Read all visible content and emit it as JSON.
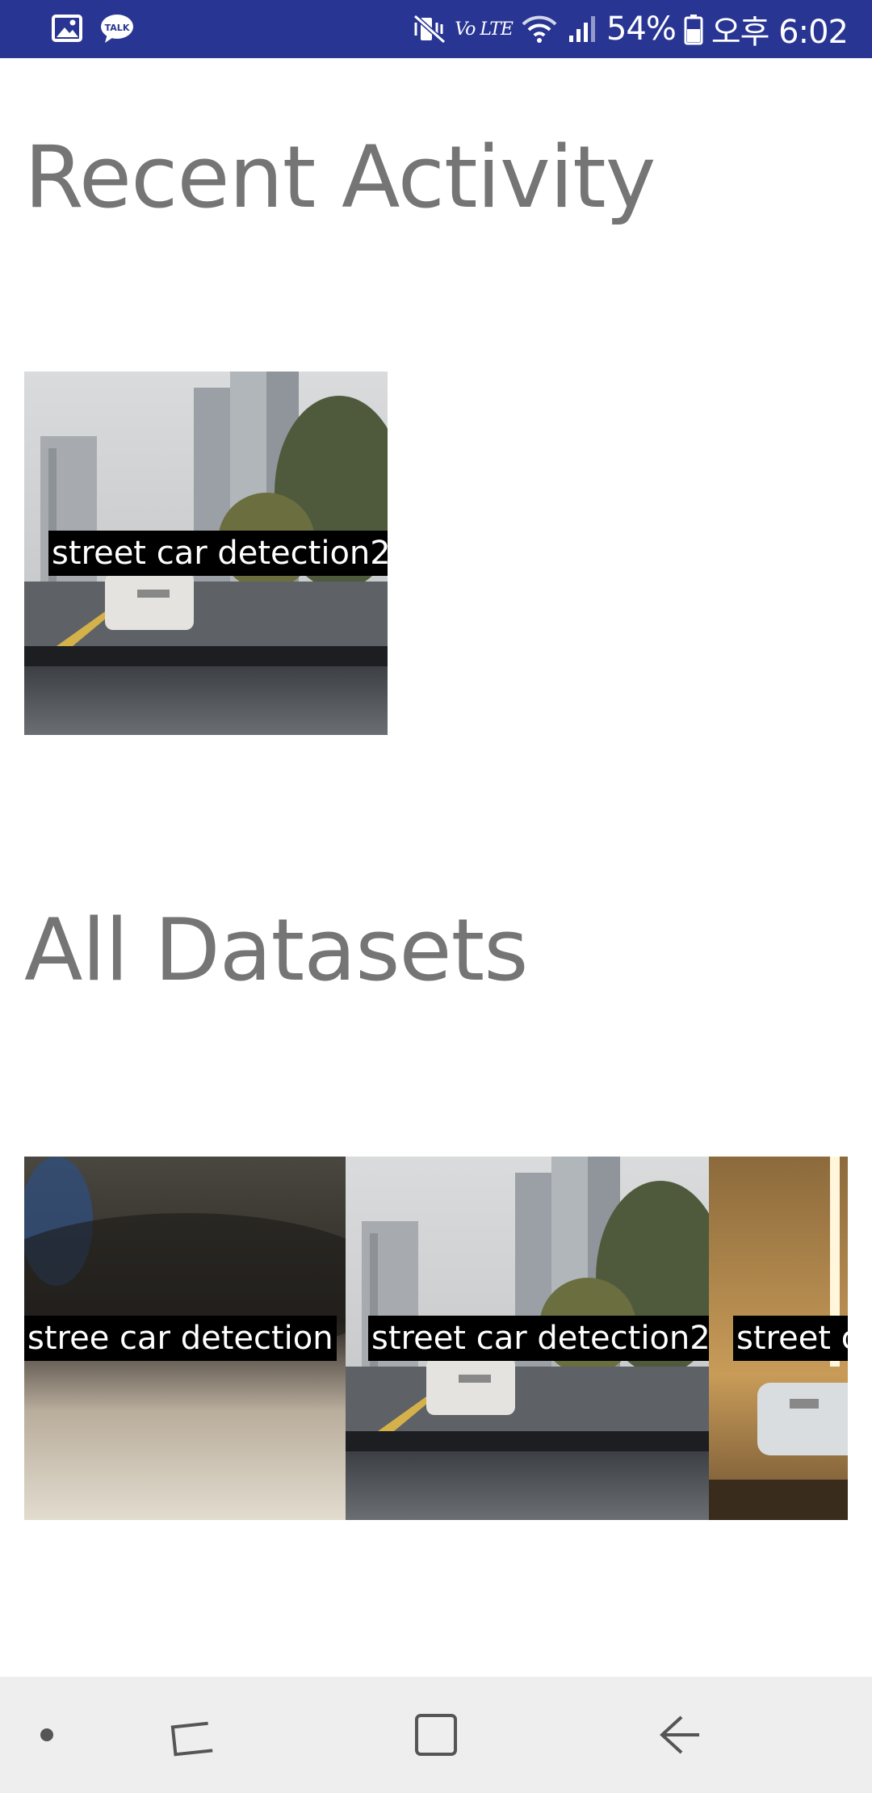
{
  "status_bar": {
    "battery": "54%",
    "time": "오후 6:02",
    "network_label": "Vo LTE",
    "left_icons": [
      "gallery-icon",
      "kakaotalk-icon"
    ],
    "kakaotalk_text": "TALK",
    "right_icons": [
      "mute-vibrate-icon",
      "volte-icon",
      "wifi-icon",
      "signal-icon",
      "battery-icon"
    ],
    "bar_color": "#283593"
  },
  "recent": {
    "title": "Recent Activity",
    "items": [
      {
        "label": "street car detection2",
        "image": "city-street-windshield-photo"
      }
    ]
  },
  "datasets": {
    "title": "All Datasets",
    "items": [
      {
        "label": "stree car detection",
        "image": "blurry-interior-photo"
      },
      {
        "label": "street car detection2",
        "image": "city-street-windshield-photo"
      },
      {
        "label": "street c",
        "image": "tunnel-car-photo"
      }
    ]
  },
  "nav_bar": {
    "buttons": [
      "dot-indicator-icon",
      "recent-apps-icon",
      "home-icon",
      "back-icon"
    ],
    "bar_color": "#eeeeee"
  },
  "colors": {
    "heading": "#757575",
    "label_bg": "#000000",
    "label_text": "#ffffff"
  }
}
